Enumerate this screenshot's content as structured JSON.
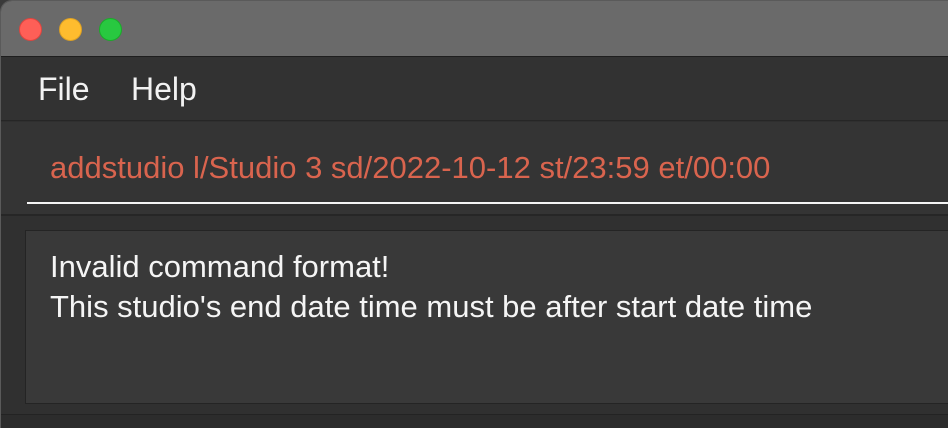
{
  "window": {
    "controls": [
      "close",
      "minimize",
      "zoom"
    ],
    "colors": {
      "close": "#fe5f57",
      "minimize": "#febc2e",
      "zoom": "#28c840",
      "command_text": "#d9644e",
      "result_text": "#f5f5f5"
    }
  },
  "menubar": {
    "items": [
      {
        "label": "File"
      },
      {
        "label": "Help"
      }
    ]
  },
  "command": {
    "value": "addstudio l/Studio 3 sd/2022-10-12 st/23:59 et/00:00"
  },
  "result": {
    "lines": [
      "Invalid command format!",
      "This studio's end date time must be after start date time"
    ]
  }
}
